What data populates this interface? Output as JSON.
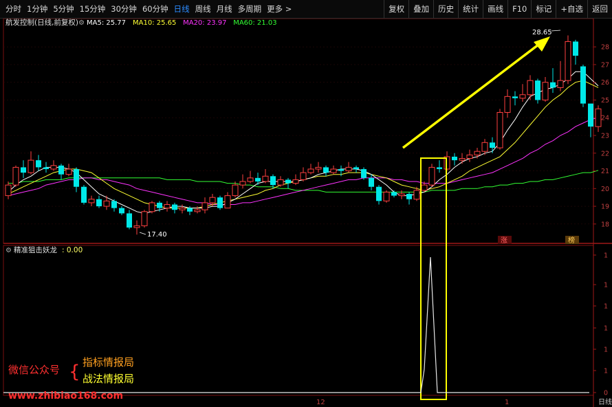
{
  "toolbar": {
    "periods": [
      "分时",
      "1分钟",
      "5分钟",
      "15分钟",
      "30分钟",
      "60分钟",
      "日线",
      "周线",
      "月线",
      "多周期",
      "更多 >"
    ],
    "active_period": "日线",
    "buttons": [
      "复权",
      "叠加",
      "历史",
      "统计",
      "画线",
      "F10",
      "标记",
      "+自选",
      "返回"
    ]
  },
  "main_panel": {
    "stock_title": "航发控制(日线,前复权)",
    "ma_legend": [
      {
        "label": "MA5: 25.77",
        "color": "#ffffff"
      },
      {
        "label": "MA10: 25.65",
        "color": "#ffff33"
      },
      {
        "label": "MA20: 23.97",
        "color": "#ff33ff"
      },
      {
        "label": "MA60: 21.03",
        "color": "#33ff33"
      }
    ],
    "price_axis_labels": [
      "28",
      "27",
      "26",
      "25",
      "24",
      "23",
      "22",
      "21",
      "20",
      "19",
      "18"
    ],
    "high_annotation": "28.65",
    "low_annotation": "17.40",
    "badges": [
      "涨",
      "榜"
    ]
  },
  "indicator_panel": {
    "title": "精准狙击妖龙",
    "value": ": 0.00",
    "axis_labels": [
      "1",
      "1",
      "1",
      "1",
      "1",
      "1",
      "0"
    ]
  },
  "bottom_labels": {
    "axis_marks": [
      "12",
      "1"
    ],
    "corner": "日线"
  },
  "watermark": {
    "prefix": "微信公众号",
    "line1": "指标情报局",
    "line2": "战法情报局",
    "url": "www.zhibiao168.com"
  },
  "colors": {
    "up": "#ff4040",
    "down": "#00e8e8",
    "ma5": "#ffffff",
    "ma10": "#ffff33",
    "ma20": "#ff33ff",
    "ma60": "#33ff33",
    "highlight": "#ffff00",
    "accent_blue": "#2d8cff"
  },
  "candles": [
    [
      19.6,
      20.2,
      20.4,
      19.4
    ],
    [
      20.2,
      21.2,
      21.3,
      20.1
    ],
    [
      21.2,
      20.9,
      21.6,
      20.6
    ],
    [
      20.9,
      21.6,
      22.1,
      20.8
    ],
    [
      21.6,
      21.2,
      21.9,
      21.0
    ],
    [
      21.2,
      21.1,
      21.5,
      20.9
    ],
    [
      21.1,
      21.3,
      21.6,
      21.0
    ],
    [
      21.3,
      20.8,
      21.4,
      20.5
    ],
    [
      20.8,
      21.1,
      21.4,
      20.7
    ],
    [
      21.1,
      20.1,
      21.2,
      19.8
    ],
    [
      20.1,
      19.2,
      20.2,
      19.1
    ],
    [
      19.2,
      19.4,
      19.6,
      19.0
    ],
    [
      19.4,
      19.0,
      19.6,
      18.9
    ],
    [
      19.0,
      19.3,
      19.6,
      18.8
    ],
    [
      19.3,
      18.9,
      19.4,
      18.7
    ],
    [
      18.9,
      18.6,
      19.0,
      18.5
    ],
    [
      18.6,
      17.8,
      18.8,
      17.7
    ],
    [
      17.8,
      17.9,
      18.2,
      17.4
    ],
    [
      17.9,
      18.7,
      18.8,
      17.8
    ],
    [
      18.7,
      19.2,
      19.3,
      18.6
    ],
    [
      19.2,
      18.9,
      19.3,
      18.7
    ],
    [
      18.9,
      19.1,
      19.3,
      18.7
    ],
    [
      19.1,
      18.8,
      19.2,
      18.6
    ],
    [
      18.8,
      18.9,
      19.1,
      18.6
    ],
    [
      18.9,
      18.7,
      19.0,
      18.5
    ],
    [
      18.7,
      18.8,
      19.0,
      18.6
    ],
    [
      18.8,
      19.2,
      19.5,
      18.6
    ],
    [
      19.2,
      19.5,
      19.7,
      19.0
    ],
    [
      19.5,
      18.9,
      19.6,
      18.8
    ],
    [
      18.9,
      19.6,
      19.8,
      18.9
    ],
    [
      19.6,
      20.2,
      20.4,
      19.5
    ],
    [
      20.2,
      20.4,
      20.8,
      20.0
    ],
    [
      20.4,
      20.6,
      21.0,
      20.3
    ],
    [
      20.6,
      20.4,
      20.9,
      20.2
    ],
    [
      20.4,
      20.7,
      21.1,
      20.3
    ],
    [
      20.7,
      20.2,
      20.8,
      20.0
    ],
    [
      20.2,
      20.5,
      20.7,
      20.1
    ],
    [
      20.5,
      20.3,
      20.6,
      20.0
    ],
    [
      20.3,
      20.5,
      20.8,
      20.2
    ],
    [
      20.5,
      20.9,
      21.2,
      20.4
    ],
    [
      20.9,
      21.1,
      21.4,
      20.8
    ],
    [
      21.1,
      21.2,
      21.5,
      20.9
    ],
    [
      21.2,
      20.9,
      21.3,
      20.7
    ],
    [
      20.9,
      21.1,
      21.3,
      20.8
    ],
    [
      21.1,
      21.0,
      21.3,
      20.7
    ],
    [
      21.0,
      21.2,
      21.5,
      20.9
    ],
    [
      21.2,
      21.1,
      21.3,
      20.9
    ],
    [
      21.1,
      20.6,
      21.2,
      20.5
    ],
    [
      20.6,
      20.1,
      20.8,
      19.9
    ],
    [
      20.1,
      19.3,
      20.2,
      19.1
    ],
    [
      19.3,
      19.8,
      19.9,
      19.2
    ],
    [
      19.8,
      19.6,
      19.9,
      19.5
    ],
    [
      19.6,
      19.7,
      19.9,
      19.4
    ],
    [
      19.7,
      19.4,
      19.8,
      19.1
    ],
    [
      19.4,
      19.9,
      20.1,
      19.3
    ],
    [
      19.9,
      20.2,
      20.4,
      19.8
    ],
    [
      20.2,
      21.2,
      21.4,
      20.1
    ],
    [
      21.2,
      21.1,
      21.6,
      20.9
    ],
    [
      21.1,
      21.8,
      22.1,
      21.0
    ],
    [
      21.8,
      21.6,
      22.0,
      21.3
    ],
    [
      21.6,
      21.7,
      22.0,
      21.4
    ],
    [
      21.7,
      21.9,
      22.2,
      21.5
    ],
    [
      21.9,
      22.1,
      22.3,
      21.7
    ],
    [
      22.1,
      22.6,
      22.8,
      21.9
    ],
    [
      22.6,
      22.3,
      22.9,
      22.0
    ],
    [
      22.3,
      24.3,
      24.5,
      22.2
    ],
    [
      24.3,
      25.2,
      25.6,
      24.0
    ],
    [
      25.2,
      25.1,
      25.5,
      24.7
    ],
    [
      25.1,
      25.3,
      25.9,
      24.9
    ],
    [
      25.3,
      26.1,
      26.4,
      25.0
    ],
    [
      26.1,
      25.0,
      26.2,
      24.8
    ],
    [
      25.0,
      26.0,
      26.3,
      24.9
    ],
    [
      26.0,
      25.7,
      26.8,
      25.4
    ],
    [
      25.7,
      26.1,
      27.2,
      25.5
    ],
    [
      26.1,
      28.3,
      28.65,
      25.9
    ],
    [
      28.3,
      27.5,
      28.4,
      27.0
    ],
    [
      26.9,
      24.8,
      27.0,
      24.6
    ],
    [
      24.8,
      23.5,
      24.3,
      22.9
    ],
    [
      23.5,
      24.5,
      24.7,
      23.2
    ]
  ],
  "ma_values": {
    "ma5": [
      19.8,
      20.2,
      20.5,
      20.7,
      21.0,
      21.2,
      21.2,
      21.2,
      21.1,
      20.9,
      20.5,
      20.1,
      19.7,
      19.5,
      19.3,
      19.1,
      18.9,
      18.7,
      18.6,
      18.7,
      18.8,
      18.9,
      19.0,
      19.0,
      18.9,
      18.9,
      18.9,
      19.0,
      19.0,
      19.2,
      19.4,
      19.7,
      20.0,
      20.3,
      20.4,
      20.4,
      20.4,
      20.4,
      20.4,
      20.5,
      20.6,
      20.8,
      20.9,
      21.0,
      21.1,
      21.1,
      21.1,
      21.0,
      20.8,
      20.5,
      20.2,
      19.8,
      19.6,
      19.6,
      19.7,
      19.8,
      20.1,
      20.5,
      20.8,
      21.2,
      21.5,
      21.7,
      21.8,
      22.0,
      22.1,
      22.6,
      23.3,
      23.9,
      24.6,
      25.2,
      25.4,
      25.6,
      25.7,
      25.9,
      26.2,
      26.6,
      26.6,
      26.2,
      25.8
    ],
    "ma10": [
      19.7,
      19.9,
      20.1,
      20.3,
      20.5,
      20.7,
      20.9,
      21.0,
      21.1,
      21.1,
      21.0,
      20.9,
      20.6,
      20.3,
      20.0,
      19.8,
      19.6,
      19.4,
      19.2,
      19.1,
      19.0,
      18.9,
      18.9,
      18.9,
      18.9,
      18.9,
      19.0,
      19.1,
      19.2,
      19.3,
      19.4,
      19.5,
      19.6,
      19.7,
      19.9,
      20.0,
      20.2,
      20.3,
      20.4,
      20.5,
      20.6,
      20.7,
      20.7,
      20.8,
      20.8,
      20.9,
      20.9,
      20.9,
      20.8,
      20.7,
      20.6,
      20.4,
      20.2,
      20.1,
      20.0,
      19.9,
      20.0,
      20.1,
      20.3,
      20.5,
      20.7,
      21.0,
      21.2,
      21.4,
      21.6,
      21.8,
      22.2,
      22.6,
      23.1,
      23.6,
      24.1,
      24.6,
      25.0,
      25.3,
      25.7,
      26.0,
      26.1,
      25.9,
      25.7
    ],
    "ma20": [
      19.6,
      19.7,
      19.8,
      19.9,
      20.0,
      20.2,
      20.3,
      20.4,
      20.5,
      20.5,
      20.6,
      20.6,
      20.5,
      20.5,
      20.4,
      20.3,
      20.2,
      20.0,
      19.9,
      19.8,
      19.7,
      19.6,
      19.5,
      19.4,
      19.3,
      19.2,
      19.2,
      19.1,
      19.1,
      19.1,
      19.1,
      19.2,
      19.2,
      19.3,
      19.4,
      19.5,
      19.6,
      19.7,
      19.8,
      19.9,
      20.0,
      20.1,
      20.2,
      20.3,
      20.4,
      20.5,
      20.5,
      20.6,
      20.6,
      20.6,
      20.6,
      20.5,
      20.5,
      20.4,
      20.4,
      20.3,
      20.3,
      20.3,
      20.3,
      20.4,
      20.5,
      20.6,
      20.7,
      20.8,
      20.9,
      21.1,
      21.3,
      21.5,
      21.7,
      22.0,
      22.2,
      22.5,
      22.7,
      23.0,
      23.2,
      23.5,
      23.7,
      23.9,
      24.0
    ],
    "ma60": [
      20.3,
      20.3,
      20.4,
      20.4,
      20.4,
      20.5,
      20.5,
      20.5,
      20.6,
      20.6,
      20.6,
      20.6,
      20.6,
      20.6,
      20.6,
      20.6,
      20.6,
      20.6,
      20.6,
      20.6,
      20.6,
      20.5,
      20.5,
      20.5,
      20.5,
      20.4,
      20.4,
      20.4,
      20.4,
      20.3,
      20.3,
      20.2,
      20.2,
      20.1,
      20.1,
      20.1,
      20.0,
      20.0,
      19.9,
      19.9,
      19.9,
      19.9,
      19.8,
      19.8,
      19.8,
      19.8,
      19.8,
      19.8,
      19.8,
      19.8,
      19.8,
      19.8,
      19.8,
      19.8,
      19.8,
      19.8,
      19.9,
      19.9,
      19.9,
      19.9,
      20.0,
      20.0,
      20.0,
      20.1,
      20.1,
      20.2,
      20.2,
      20.3,
      20.3,
      20.4,
      20.4,
      20.5,
      20.5,
      20.6,
      20.7,
      20.8,
      20.9,
      20.9,
      21.03
    ]
  }
}
